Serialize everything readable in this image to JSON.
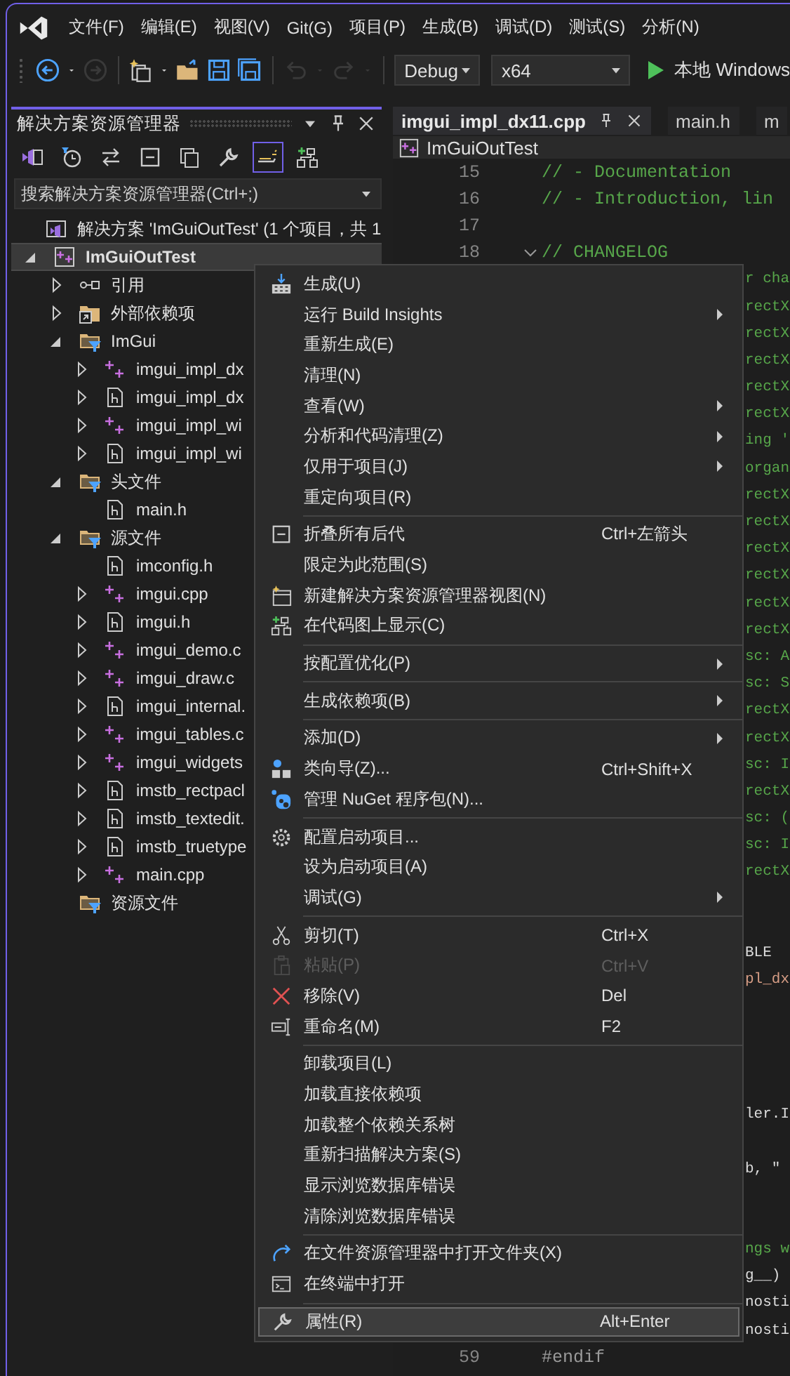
{
  "menu_bar": {
    "items": [
      "文件(F)",
      "编辑(E)",
      "视图(V)",
      "Git(G)",
      "项目(P)",
      "生成(B)",
      "调试(D)",
      "测试(S)",
      "分析(N)"
    ]
  },
  "toolbar": {
    "buttons": [
      {
        "kind": "back",
        "disabled": false
      },
      {
        "kind": "caret",
        "disabled": false
      },
      {
        "kind": "forward",
        "disabled": true
      },
      {
        "kind": "sep",
        "disabled": false
      },
      {
        "kind": "new-project",
        "disabled": false
      },
      {
        "kind": "caret",
        "disabled": false
      },
      {
        "kind": "open",
        "disabled": false
      },
      {
        "kind": "save",
        "disabled": false
      },
      {
        "kind": "save-all",
        "disabled": false
      },
      {
        "kind": "sep",
        "disabled": false
      },
      {
        "kind": "undo",
        "disabled": true
      },
      {
        "kind": "caret",
        "disabled": true
      },
      {
        "kind": "redo",
        "disabled": true
      },
      {
        "kind": "caret",
        "disabled": true
      },
      {
        "kind": "sep",
        "disabled": false
      }
    ],
    "configuration": "Debug",
    "platform": "x64",
    "run_label": "本地 Windows"
  },
  "solution_explorer": {
    "title": "解决方案资源管理器",
    "tools": [
      {
        "kind": "switch-view",
        "selected": false
      },
      {
        "kind": "history",
        "selected": false
      },
      {
        "kind": "sync",
        "selected": false
      },
      {
        "kind": "collapse",
        "selected": false
      },
      {
        "kind": "copies",
        "selected": false
      },
      {
        "kind": "properties",
        "selected": false
      },
      {
        "kind": "preview",
        "selected": true
      },
      {
        "kind": "codemap",
        "selected": false
      }
    ],
    "search": {
      "placeholder": "搜索解决方案资源管理器(Ctrl+;)"
    },
    "tree": [
      {
        "label": "解决方案 'ImGuiOutTest' (1 个项目，共 1",
        "kind": "solution",
        "selected": false,
        "children": [
          {
            "label": "ImGuiOutTest",
            "kind": "project",
            "expanded": true,
            "selected": true,
            "children": [
              {
                "label": "引用",
                "kind": "ref",
                "expanded": false,
                "selected": false
              },
              {
                "label": "外部依赖项",
                "kind": "external",
                "expanded": false,
                "selected": false
              },
              {
                "label": "ImGui",
                "kind": "filter",
                "expanded": true,
                "selected": false,
                "children": [
                  {
                    "label": "imgui_impl_dx",
                    "kind": "cpp",
                    "expanded": false,
                    "selected": false
                  },
                  {
                    "label": "imgui_impl_dx",
                    "kind": "header",
                    "expanded": false,
                    "selected": false
                  },
                  {
                    "label": "imgui_impl_wi",
                    "kind": "cpp",
                    "expanded": false,
                    "selected": false
                  },
                  {
                    "label": "imgui_impl_wi",
                    "kind": "header",
                    "expanded": false,
                    "selected": false
                  }
                ]
              },
              {
                "label": "头文件",
                "kind": "filter",
                "expanded": true,
                "selected": false,
                "children": [
                  {
                    "label": "main.h",
                    "kind": "header",
                    "selected": false
                  }
                ]
              },
              {
                "label": "源文件",
                "kind": "filter",
                "expanded": true,
                "selected": false,
                "children": [
                  {
                    "label": "imconfig.h",
                    "kind": "header",
                    "selected": false
                  },
                  {
                    "label": "imgui.cpp",
                    "kind": "cpp",
                    "expanded": false,
                    "selected": false
                  },
                  {
                    "label": "imgui.h",
                    "kind": "header",
                    "expanded": false,
                    "selected": false
                  },
                  {
                    "label": "imgui_demo.c",
                    "kind": "cpp",
                    "expanded": false,
                    "selected": false
                  },
                  {
                    "label": "imgui_draw.c",
                    "kind": "cpp",
                    "expanded": false,
                    "selected": false
                  },
                  {
                    "label": "imgui_internal.",
                    "kind": "header",
                    "expanded": false,
                    "selected": false
                  },
                  {
                    "label": "imgui_tables.c",
                    "kind": "cpp",
                    "expanded": false,
                    "selected": false
                  },
                  {
                    "label": "imgui_widgets",
                    "kind": "cpp",
                    "expanded": false,
                    "selected": false
                  },
                  {
                    "label": "imstb_rectpacl",
                    "kind": "header",
                    "expanded": false,
                    "selected": false
                  },
                  {
                    "label": "imstb_textedit.",
                    "kind": "header",
                    "expanded": false,
                    "selected": false
                  },
                  {
                    "label": "imstb_truetype",
                    "kind": "header",
                    "expanded": false,
                    "selected": false
                  },
                  {
                    "label": "main.cpp",
                    "kind": "cpp",
                    "expanded": false,
                    "selected": false
                  }
                ]
              },
              {
                "label": "资源文件",
                "kind": "filter",
                "selected": false
              }
            ]
          }
        ]
      }
    ]
  },
  "editor": {
    "tabs": [
      {
        "label": "imgui_impl_dx11.cpp",
        "selected": true
      },
      {
        "label": "main.h",
        "selected": false
      },
      {
        "label": "m",
        "selected": false
      }
    ],
    "nav": "ImGuiOutTest",
    "lines": [
      {
        "num": "15",
        "text": "// - Documentation",
        "kind": "comment"
      },
      {
        "num": "16",
        "text": "// - Introduction, lin",
        "kind": "comment"
      },
      {
        "num": "17",
        "kind": "blank"
      },
      {
        "num": "18",
        "text": "// CHANGELOG",
        "kind": "comment",
        "fold": true
      },
      {
        "text": "r cha",
        "kind": "comment"
      },
      {
        "text": "rectX",
        "kind": "comment"
      },
      {
        "text": "rectX",
        "kind": "comment"
      },
      {
        "text": "rectX",
        "kind": "comment"
      },
      {
        "text": "rectX",
        "kind": "comment"
      },
      {
        "text": "rectX",
        "kind": "comment"
      },
      {
        "text": "ing '",
        "kind": "comment"
      },
      {
        "text": "organ",
        "kind": "comment"
      },
      {
        "text": "rectX",
        "kind": "comment"
      },
      {
        "text": "rectX",
        "kind": "comment"
      },
      {
        "text": "rectX",
        "kind": "comment"
      },
      {
        "text": "rectX",
        "kind": "comment"
      },
      {
        "text": "rectX",
        "kind": "comment"
      },
      {
        "text": "rectX",
        "kind": "comment"
      },
      {
        "text": "sc: A",
        "kind": "comment"
      },
      {
        "text": "sc: S",
        "kind": "comment"
      },
      {
        "text": "rectX",
        "kind": "comment"
      },
      {
        "text": "rectX",
        "kind": "comment"
      },
      {
        "text": "sc: I",
        "kind": "comment"
      },
      {
        "text": "rectX",
        "kind": "comment"
      },
      {
        "text": "sc: (",
        "kind": "comment"
      },
      {
        "text": "sc: I",
        "kind": "comment"
      },
      {
        "text": "rectX",
        "kind": "comment"
      },
      {
        "kind": "blank"
      },
      {
        "kind": "blank"
      },
      {
        "text": "BLE",
        "kind": "code"
      },
      {
        "text": "pl_dx",
        "kind": "string"
      },
      {
        "kind": "blank"
      },
      {
        "kind": "blank"
      },
      {
        "kind": "blank"
      },
      {
        "kind": "blank"
      },
      {
        "text": "ler.I",
        "kind": "code"
      },
      {
        "kind": "blank"
      },
      {
        "text": "b, \"",
        "kind": "code"
      },
      {
        "kind": "blank"
      },
      {
        "kind": "blank"
      },
      {
        "text": "ngs w",
        "kind": "comment"
      },
      {
        "text": "g__)",
        "kind": "code"
      },
      {
        "text": "nosti",
        "kind": "code"
      },
      {
        "text": "nosti",
        "kind": "code"
      },
      {
        "num": "59",
        "text": "#endif",
        "kind": "preproc"
      }
    ]
  },
  "context_menu": {
    "groups": [
      [
        {
          "label": "生成(U)",
          "kind": "build",
          "submenu": false,
          "disabled": false,
          "selected": false
        },
        {
          "label": "运行 Build Insights",
          "submenu": true,
          "disabled": false,
          "selected": false
        },
        {
          "label": "重新生成(E)",
          "submenu": false,
          "disabled": false,
          "selected": false
        },
        {
          "label": "清理(N)",
          "submenu": false,
          "disabled": false,
          "selected": false
        },
        {
          "label": "查看(W)",
          "submenu": true,
          "disabled": false,
          "selected": false
        },
        {
          "label": "分析和代码清理(Z)",
          "submenu": true,
          "disabled": false,
          "selected": false
        },
        {
          "label": "仅用于项目(J)",
          "submenu": true,
          "disabled": false,
          "selected": false
        },
        {
          "label": "重定向项目(R)",
          "submenu": false,
          "disabled": false,
          "selected": false
        }
      ],
      [
        {
          "label": "折叠所有后代",
          "kind": "collapse",
          "shortcut": "Ctrl+左箭头",
          "submenu": false,
          "disabled": false,
          "selected": false
        },
        {
          "label": "限定为此范围(S)",
          "submenu": false,
          "disabled": false,
          "selected": false
        },
        {
          "label": "新建解决方案资源管理器视图(N)",
          "kind": "new-view",
          "submenu": false,
          "disabled": false,
          "selected": false
        },
        {
          "label": "在代码图上显示(C)",
          "kind": "codemap",
          "submenu": false,
          "disabled": false,
          "selected": false
        }
      ],
      [
        {
          "label": "按配置优化(P)",
          "submenu": true,
          "disabled": false,
          "selected": false
        }
      ],
      [
        {
          "label": "生成依赖项(B)",
          "submenu": true,
          "disabled": false,
          "selected": false
        }
      ],
      [
        {
          "label": "添加(D)",
          "submenu": true,
          "disabled": false,
          "selected": false
        },
        {
          "label": "类向导(Z)...",
          "kind": "class-wizard",
          "shortcut": "Ctrl+Shift+X",
          "submenu": false,
          "disabled": false,
          "selected": false
        },
        {
          "label": "管理 NuGet 程序包(N)...",
          "kind": "nuget",
          "submenu": false,
          "disabled": false,
          "selected": false
        }
      ],
      [
        {
          "label": "配置启动项目...",
          "kind": "gear",
          "submenu": false,
          "disabled": false,
          "selected": false
        },
        {
          "label": "设为启动项目(A)",
          "submenu": false,
          "disabled": false,
          "selected": false
        },
        {
          "label": "调试(G)",
          "submenu": true,
          "disabled": false,
          "selected": false
        }
      ],
      [
        {
          "label": "剪切(T)",
          "kind": "cut",
          "shortcut": "Ctrl+X",
          "submenu": false,
          "disabled": false,
          "selected": false
        },
        {
          "label": "粘贴(P)",
          "kind": "paste",
          "shortcut": "Ctrl+V",
          "submenu": false,
          "disabled": true,
          "selected": false
        },
        {
          "label": "移除(V)",
          "kind": "remove",
          "shortcut": "Del",
          "submenu": false,
          "disabled": false,
          "selected": false
        },
        {
          "label": "重命名(M)",
          "kind": "rename",
          "shortcut": "F2",
          "submenu": false,
          "disabled": false,
          "selected": false
        }
      ],
      [
        {
          "label": "卸载项目(L)",
          "submenu": false,
          "disabled": false,
          "selected": false
        },
        {
          "label": "加载直接依赖项",
          "submenu": false,
          "disabled": false,
          "selected": false
        },
        {
          "label": "加载整个依赖关系树",
          "submenu": false,
          "disabled": false,
          "selected": false
        },
        {
          "label": "重新扫描解决方案(S)",
          "submenu": false,
          "disabled": false,
          "selected": false
        },
        {
          "label": "显示浏览数据库错误",
          "submenu": false,
          "disabled": false,
          "selected": false
        },
        {
          "label": "清除浏览数据库错误",
          "submenu": false,
          "disabled": false,
          "selected": false
        }
      ],
      [
        {
          "label": "在文件资源管理器中打开文件夹(X)",
          "kind": "curve-arrow",
          "submenu": false,
          "disabled": false,
          "selected": false
        },
        {
          "label": "在终端中打开",
          "kind": "terminal",
          "submenu": false,
          "disabled": false,
          "selected": false
        }
      ],
      [
        {
          "label": "属性(R)",
          "kind": "wrench",
          "shortcut": "Alt+Enter",
          "submenu": false,
          "disabled": false,
          "selected": true
        }
      ]
    ]
  }
}
